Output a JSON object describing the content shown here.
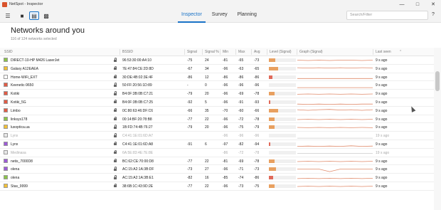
{
  "window": {
    "title": "NetSpot - Inspector"
  },
  "toolbar": {
    "menu_icon": "hamburger-icon",
    "tabs": [
      {
        "label": "Inspector",
        "active": true
      },
      {
        "label": "Survey",
        "active": false
      },
      {
        "label": "Planning",
        "active": false
      }
    ],
    "search_placeholder": "Search/Filter",
    "help_label": "?"
  },
  "page": {
    "title": "Networks around you",
    "subtitle": "116 of 124 networks selected"
  },
  "columns": [
    "SSID",
    "BSSID",
    "Signal",
    "Signal %",
    "Min",
    "Max",
    "Avg",
    "Level (Signal)",
    "Graph (Signal)",
    "Last seen"
  ],
  "colors": {
    "accent": "#1a73c7",
    "level_orange": "#e8a060",
    "level_red": "#e06a5a"
  },
  "networks": [
    {
      "ssid": "DIRECT-10-HP M426 LaserJet",
      "bssid": "96:53:30:00:A4:10",
      "signal": "-75",
      "pct": "24",
      "min": "-81",
      "max": "-65",
      "avg": "-73",
      "last": "9 s ago",
      "color": "#8bc34a",
      "checked": true,
      "faded": false,
      "level": 0.24,
      "spark": [
        0.5,
        0.55,
        0.5,
        0.55,
        0.5,
        0.5,
        0.55,
        0.5
      ]
    },
    {
      "ssid": "Galaxy A12EAEA",
      "bssid": "7E:47:84:CE:2D:8D",
      "signal": "-67",
      "pct": "34",
      "min": "-96",
      "max": "-63",
      "avg": "-65",
      "last": "9 s ago",
      "color": "#f2c037",
      "checked": true,
      "faded": false,
      "level": 0.34,
      "spark": [
        0.35,
        0.4,
        0.35,
        0.4,
        0.35,
        0.4,
        0.35,
        0.38
      ]
    },
    {
      "ssid": "Home-WiFi_EXT",
      "bssid": "30:DE:4B:02:3E:4F",
      "signal": "-86",
      "pct": "12",
      "min": "-86",
      "max": "-86",
      "avg": "-86",
      "last": "9 s ago",
      "color": "#ffffff",
      "checked": false,
      "faded": false,
      "level": 0.12,
      "spark": [
        0.7,
        0.7,
        0.7,
        0.7,
        0.7,
        0.7,
        0.7,
        0.7
      ]
    },
    {
      "ssid": "Keenetic-9650",
      "bssid": "50:FF:20:56:1D:89",
      "signal": "-",
      "pct": "0",
      "min": "-96",
      "max": "-96",
      "avg": "-96",
      "last": "9 s ago",
      "color": "#e25b45",
      "checked": true,
      "faded": false,
      "level": 0.0,
      "spark": [
        0.9,
        0.9,
        0.9,
        0.9,
        0.9,
        0.9,
        0.9,
        0.9
      ]
    },
    {
      "ssid": "Kotiki",
      "bssid": "B4:0F:3B:0B:C7:21",
      "signal": "-79",
      "pct": "20",
      "min": "-96",
      "max": "-69",
      "avg": "-78",
      "last": "9 s ago",
      "color": "#e25b45",
      "checked": true,
      "faded": false,
      "level": 0.2,
      "spark": [
        0.6,
        0.55,
        0.6,
        0.55,
        0.6,
        0.55,
        0.6,
        0.55
      ]
    },
    {
      "ssid": "Kotiki_5G",
      "bssid": "B4:0F:3B:0B:C7:25",
      "signal": "-92",
      "pct": "5",
      "min": "-96",
      "max": "-91",
      "avg": "-93",
      "last": "9 s ago",
      "color": "#e25b45",
      "checked": true,
      "faded": false,
      "level": 0.05,
      "spark": [
        0.8,
        0.85,
        0.8,
        0.85,
        0.8,
        0.85,
        0.8,
        0.8
      ]
    },
    {
      "ssid": "Limbo",
      "bssid": "0C:80:63:46:DF:C6",
      "signal": "-66",
      "pct": "35",
      "min": "-70",
      "max": "-60",
      "avg": "-66",
      "last": "9 s ago",
      "color": "#e25b45",
      "checked": true,
      "faded": false,
      "level": 0.35,
      "spark": [
        0.35,
        0.45,
        0.35,
        0.3,
        0.4,
        0.35,
        0.45,
        0.35
      ]
    },
    {
      "ssid": "linksys178",
      "bssid": "00:14:BF:20:78:B8",
      "signal": "-77",
      "pct": "22",
      "min": "-96",
      "max": "-72",
      "avg": "-78",
      "last": "9 s ago",
      "color": "#8bc34a",
      "checked": true,
      "faded": false,
      "level": 0.22,
      "spark": [
        0.55,
        0.5,
        0.55,
        0.5,
        0.55,
        0.5,
        0.55,
        0.5
      ]
    },
    {
      "ssid": "luxoptica.ua",
      "bssid": "1B:FD:74:4B:76:27",
      "signal": "-79",
      "pct": "20",
      "min": "-96",
      "max": "-75",
      "avg": "-79",
      "last": "9 s ago",
      "color": "#f2c037",
      "checked": true,
      "faded": false,
      "level": 0.2,
      "spark": [
        0.55,
        0.6,
        0.55,
        0.6,
        0.55,
        0.6,
        0.55,
        0.6
      ]
    },
    {
      "ssid": "Lynx",
      "bssid": "C4:41:1E:01:6D:A7",
      "signal": "",
      "pct": "",
      "min": "-96",
      "max": "-96",
      "avg": "-96",
      "last": "19 s ago",
      "color": "#e8e8e8",
      "checked": false,
      "faded": true,
      "level": 0.0,
      "spark": [
        0.9,
        0.9,
        0.9,
        0.9,
        0.9,
        0.9,
        0.9,
        0.9
      ]
    },
    {
      "ssid": "Lynx",
      "bssid": "C4:41:1E:01:6D:A8",
      "signal": "-91",
      "pct": "6",
      "min": "-97",
      "max": "-82",
      "avg": "-94",
      "last": "9 s ago",
      "color": "#9c5bd6",
      "checked": true,
      "faded": false,
      "level": 0.06,
      "spark": [
        0.85,
        0.8,
        0.85,
        0.8,
        0.85,
        0.75,
        0.85,
        0.8
      ]
    },
    {
      "ssid": "Medinasa",
      "bssid": "6A:5E:83:4E:7E:8E",
      "signal": "",
      "pct": "",
      "min": "-86",
      "max": "-72",
      "avg": "-78",
      "last": "19 s ago",
      "color": "#e8e8e8",
      "checked": false,
      "faded": true,
      "level": 0.0,
      "spark": [
        0.6,
        0.6,
        0.6,
        0.6,
        0.6,
        0.6,
        0.6,
        0.6
      ]
    },
    {
      "ssid": "netis_7000D8",
      "bssid": "BC:62:CE:70:00:D8",
      "signal": "-77",
      "pct": "22",
      "min": "-81",
      "max": "-69",
      "avg": "-78",
      "last": "9 s ago",
      "color": "#9c5bd6",
      "checked": true,
      "faded": false,
      "level": 0.22,
      "spark": [
        0.55,
        0.5,
        0.55,
        0.5,
        0.55,
        0.5,
        0.55,
        0.5
      ]
    },
    {
      "ssid": "olena",
      "bssid": "AC:15:A2:1A:3B:DF",
      "signal": "-73",
      "pct": "27",
      "min": "-96",
      "max": "-71",
      "avg": "-73",
      "last": "9 s ago",
      "color": "#9c5bd6",
      "checked": true,
      "faded": false,
      "level": 0.27,
      "spark": [
        0.5,
        0.5,
        0.5,
        0.9,
        0.5,
        0.5,
        0.5,
        0.5
      ]
    },
    {
      "ssid": "olena",
      "bssid": "AC:15:A2:1A:3B:E1",
      "signal": "-82",
      "pct": "16",
      "min": "-85",
      "max": "-74",
      "avg": "-86",
      "last": "9 s ago",
      "color": "#8bc34a",
      "checked": true,
      "faded": false,
      "level": 0.16,
      "spark": [
        0.65,
        0.6,
        0.65,
        0.6,
        0.65,
        0.6,
        0.65,
        0.6
      ]
    },
    {
      "ssid": "Stas_9999",
      "bssid": "38:6B:1C:43:9D:2E",
      "signal": "-77",
      "pct": "22",
      "min": "-96",
      "max": "-73",
      "avg": "-75",
      "last": "9 s ago",
      "color": "#f2c037",
      "checked": true,
      "faded": false,
      "level": 0.22,
      "spark": [
        0.55,
        0.5,
        0.55,
        0.5,
        0.55,
        0.5,
        0.55,
        0.5
      ]
    }
  ]
}
